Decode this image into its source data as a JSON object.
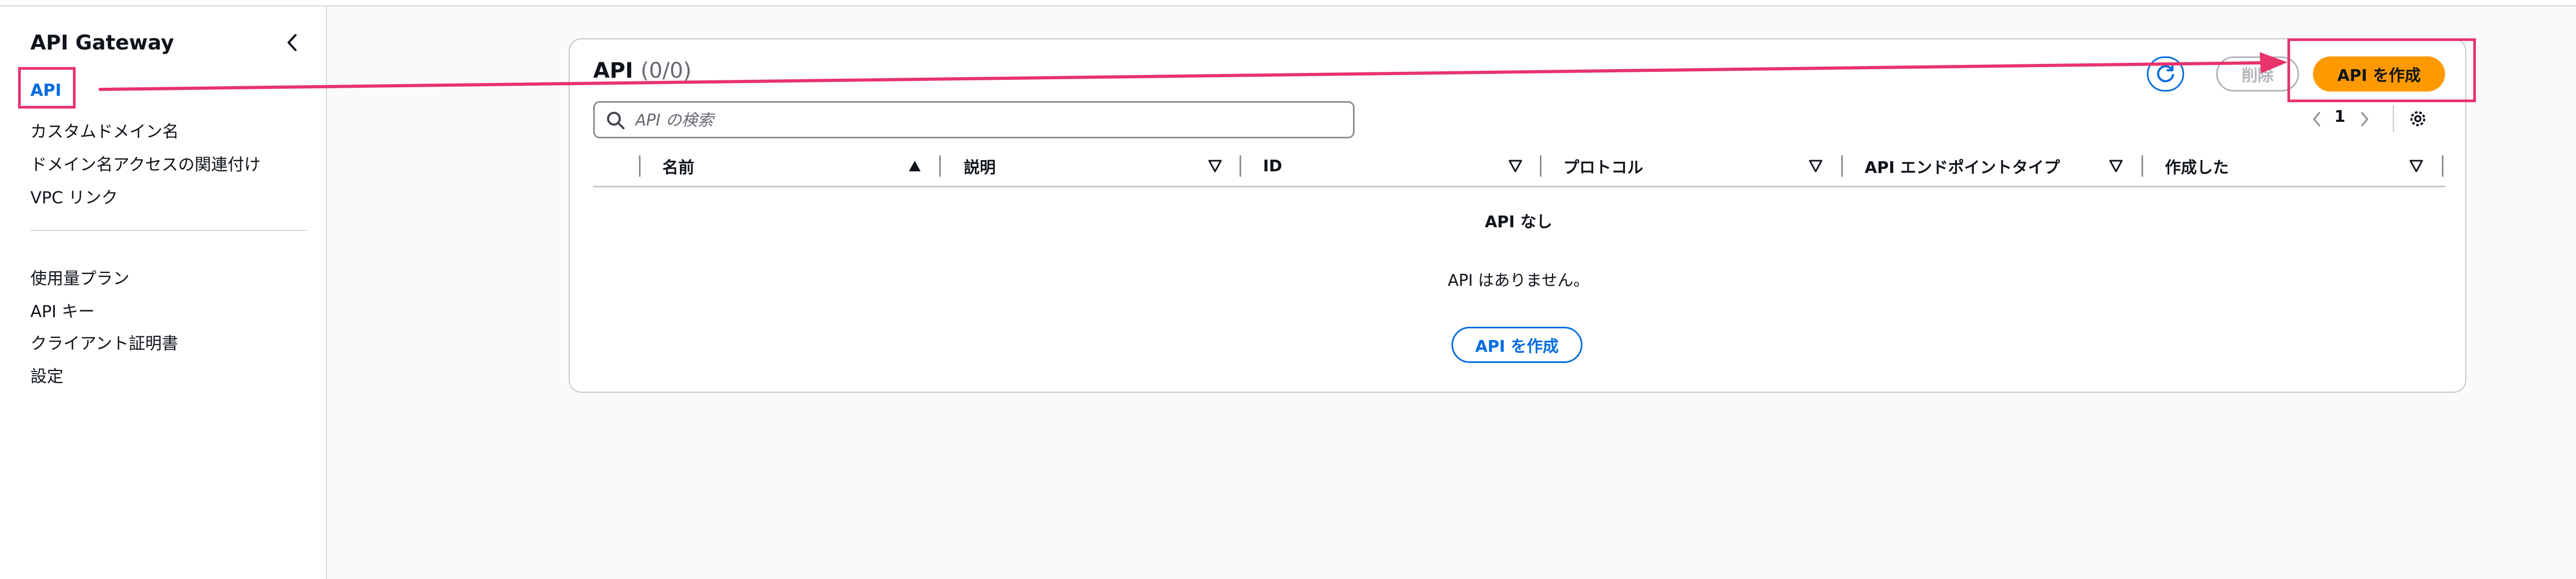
{
  "sidebar": {
    "title": "API Gateway",
    "items_primary": [
      "API",
      "カスタムドメイン名",
      "ドメイン名アクセスの関連付け",
      "VPC リンク"
    ],
    "items_secondary": [
      "使用量プラン",
      "API キー",
      "クライアント証明書",
      "設定"
    ]
  },
  "main": {
    "title": "API",
    "count": "(0/0)",
    "delete_label": "削除",
    "create_label": "API を作成",
    "search_placeholder": "API の検索",
    "page": "1",
    "columns": [
      "名前",
      "説明",
      "ID",
      "プロトコル",
      "API エンドポイントタイプ",
      "作成した"
    ],
    "empty_title": "API なし",
    "empty_message": "API はありません。",
    "empty_create_label": "API を作成"
  },
  "colors": {
    "annotation": "#e8336b",
    "primary_button": "#ff9900",
    "link_blue": "#006ce0"
  }
}
